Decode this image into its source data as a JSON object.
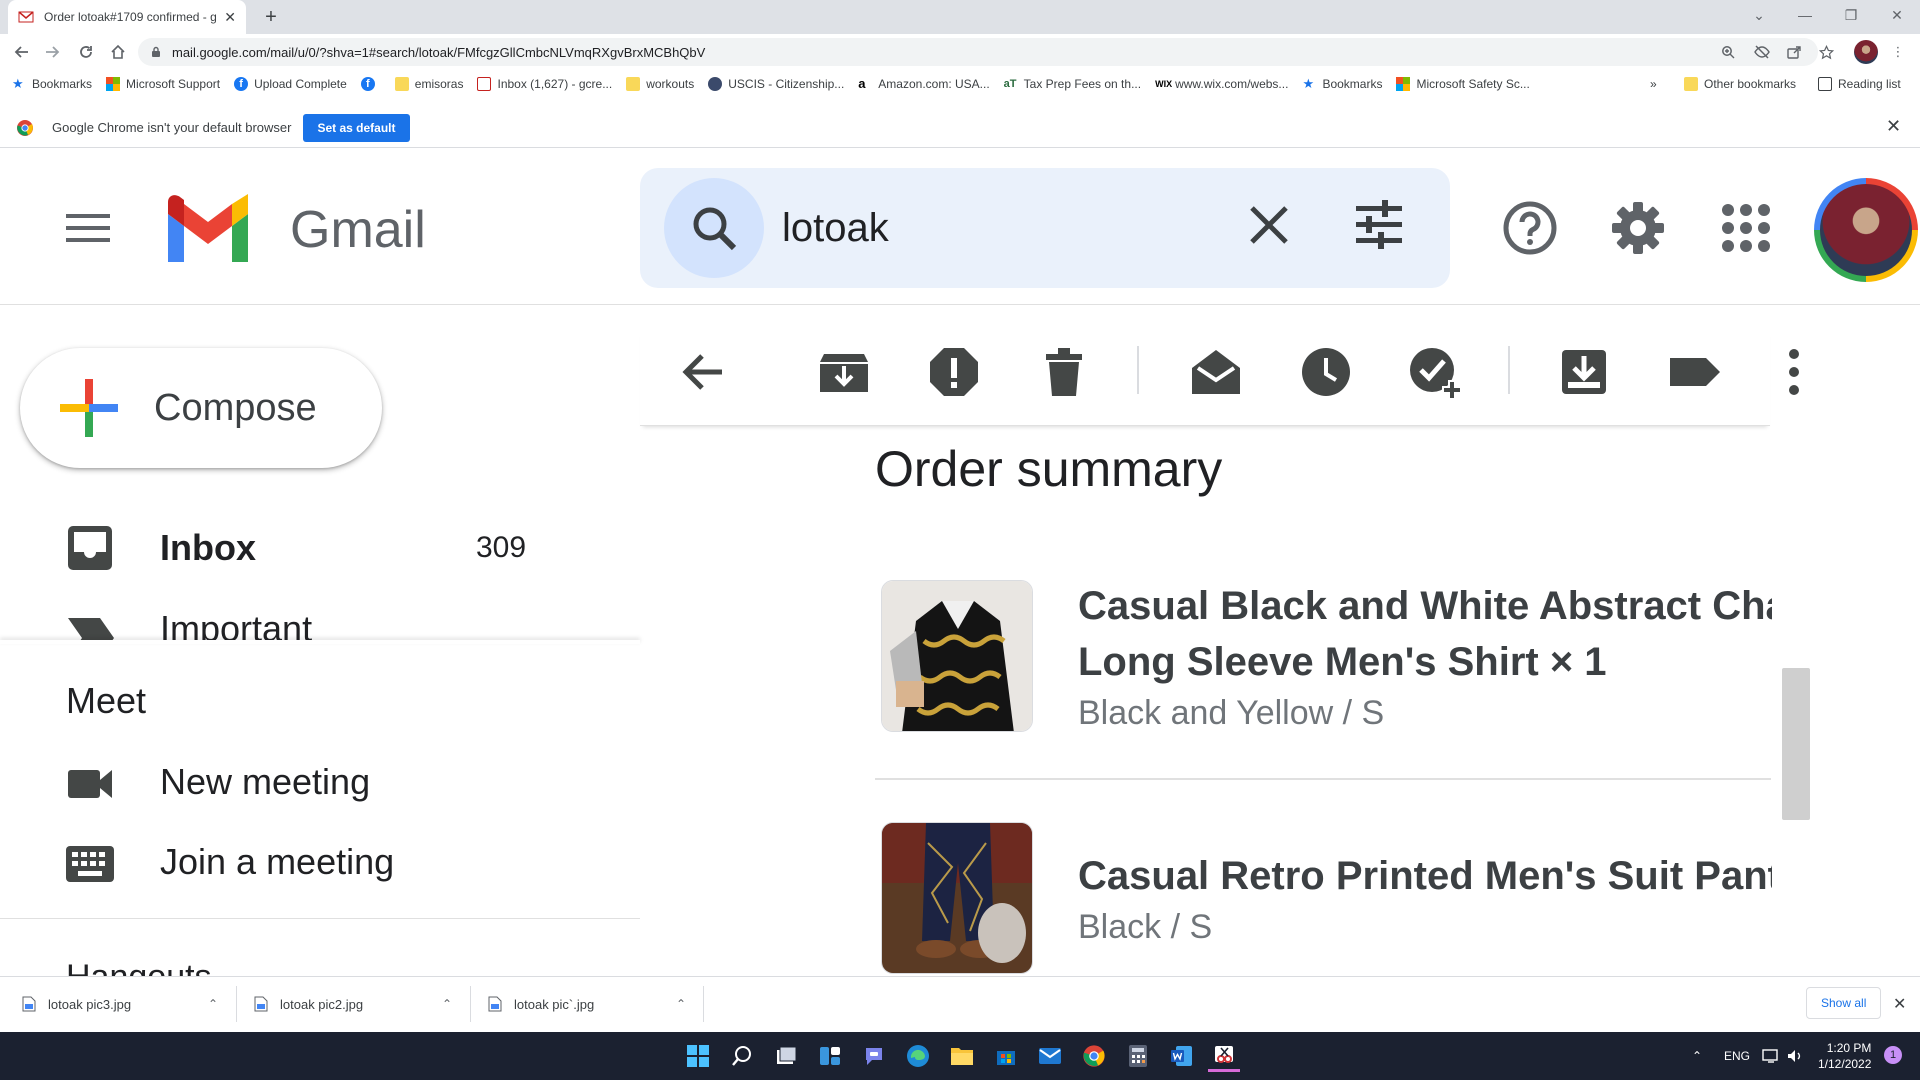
{
  "browser": {
    "tab_title": "Order lotoak#1709 confirmed - g",
    "url": "mail.google.com/mail/u/0/?shva=1#search/lotoak/FMfcgzGllCmbcNLVmqRXgvBrxMCBhQbV",
    "bookmarks": [
      {
        "label": "Bookmarks",
        "icon": "star-icon"
      },
      {
        "label": "Microsoft Support",
        "icon": "microsoft-icon"
      },
      {
        "label": "Upload Complete",
        "icon": "facebook-icon"
      },
      {
        "label": "",
        "icon": "facebook-icon"
      },
      {
        "label": "emisoras",
        "icon": "folder-icon"
      },
      {
        "label": "Inbox (1,627) - gcre...",
        "icon": "inbox-favicon"
      },
      {
        "label": "workouts",
        "icon": "folder-icon"
      },
      {
        "label": "USCIS - Citizenship...",
        "icon": "seal-icon"
      },
      {
        "label": "Amazon.com: USA...",
        "icon": "amazon-icon"
      },
      {
        "label": "Tax Prep Fees on th...",
        "icon": "at-icon"
      },
      {
        "label": "www.wix.com/webs...",
        "icon": "wix-icon"
      },
      {
        "label": "Bookmarks",
        "icon": "star-icon"
      },
      {
        "label": "Microsoft Safety Sc...",
        "icon": "microsoft-icon"
      }
    ],
    "bookmarks_overflow": "»",
    "other_bookmarks": "Other bookmarks",
    "reading_list": "Reading list",
    "default_browser_text": "Google Chrome isn't your default browser",
    "set_default_label": "Set as default"
  },
  "gmail": {
    "brand": "Gmail",
    "search_query": "lotoak",
    "compose_label": "Compose",
    "nav": [
      {
        "label": "Inbox",
        "count": "309"
      },
      {
        "label": "Important",
        "count": ""
      }
    ],
    "meet": {
      "title": "Meet",
      "items": [
        "New meeting",
        "Join a meeting"
      ]
    },
    "hangouts_peek": "Hangouts"
  },
  "message": {
    "heading": "Order summary",
    "products": [
      {
        "name_line1": "Casual Black and White Abstract Chain",
        "name_line2": "Long Sleeve Men's Shirt × 1",
        "variant": "Black and Yellow / S"
      },
      {
        "name_line1": "Casual Retro Printed Men's Suit Pants",
        "name_line2": "",
        "variant": "Black / S"
      }
    ]
  },
  "downloads": {
    "files": [
      "lotoak pic3.jpg",
      "lotoak pic2.jpg",
      "lotoak pic`.jpg"
    ],
    "show_all": "Show all"
  },
  "taskbar": {
    "lang": "ENG",
    "time": "1:20 PM",
    "date": "1/12/2022",
    "notifications": "1"
  },
  "colors": {
    "gmail_red": "#ea4335",
    "gmail_blue": "#4285f4",
    "gmail_yellow": "#fbbc04",
    "gmail_green": "#34a853",
    "chrome_blue": "#1a73e8",
    "search_bg": "#eaf1fb"
  }
}
